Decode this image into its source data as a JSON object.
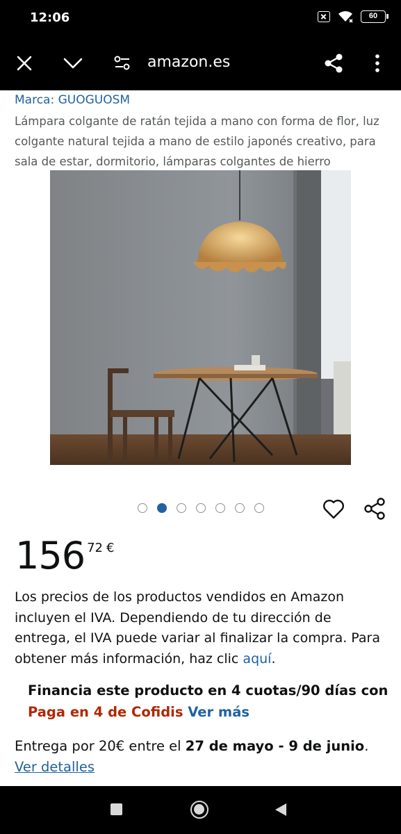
{
  "status_bar": {
    "time": "12:06",
    "battery": "60",
    "icons": [
      "sim-x-icon",
      "wifi-icon",
      "battery-icon"
    ]
  },
  "toolbar": {
    "url": "amazon.es",
    "icons": [
      "close-icon",
      "chevron-down-icon",
      "site-settings-icon",
      "share-icon",
      "more-vert-icon"
    ]
  },
  "product": {
    "brand": "Marca: GUOGUOSM",
    "title": "Lámpara colgante de ratán tejida a mano con forma de flor, luz colgante natural tejida a mano de estilo japonés creativo, para sala de estar, dormitorio, lámparas colgantes de hierro",
    "image_alt": "rattan-pendant-lamp-photo",
    "carousel": {
      "count": 7,
      "active": 2
    }
  },
  "price": {
    "whole": "156",
    "fraction": "72",
    "currency": "€"
  },
  "tax_notice": {
    "text": "Los precios de los productos vendidos en Amazon incluyen el IVA. Dependiendo de tu dirección de entrega, el IVA puede variar al finalizar la compra. Para obtener más información, haz clic ",
    "link": "aquí",
    "end": "."
  },
  "financing": {
    "text": "Financia este producto en 4 cuotas/90 días con ",
    "highlight": "Paga en 4 de Cofidis",
    "link": "Ver más"
  },
  "delivery": {
    "prefix": "Entrega por 20€ entre el ",
    "dates": "27 de mayo - 9 de junio",
    "suffix": ".",
    "link": "Ver detalles"
  },
  "nav_bar": {
    "icons": [
      "recents-square-icon",
      "home-circle-icon",
      "back-triangle-icon"
    ]
  },
  "colors": {
    "link": "#2162a1",
    "accent_red": "#b12704",
    "text": "#0f1111",
    "muted": "#565959"
  }
}
